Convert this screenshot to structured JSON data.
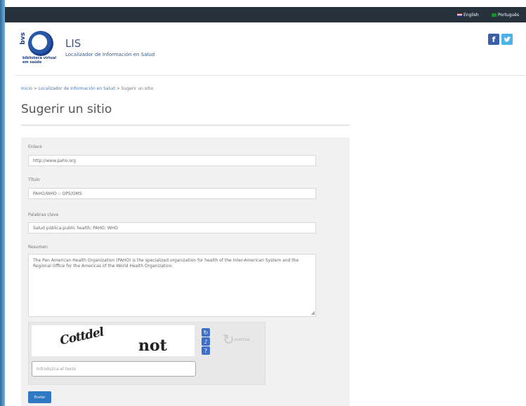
{
  "languages": {
    "english": "English",
    "portuguese": "Português"
  },
  "header": {
    "logo_side": "bvs",
    "logo_text": "biblioteca virtual em saúde",
    "app_name": "LIS",
    "app_subtitle": "Localizador de Información en Salud"
  },
  "social": {
    "facebook": "f",
    "twitter": "t"
  },
  "breadcrumb": {
    "home": "Inicio",
    "section": "Localizador de Información en Salud",
    "current": "Sugerir un sitio",
    "separator": ">"
  },
  "page_title": "Sugerir un sitio",
  "form": {
    "link_label": "Enlace",
    "link_value": "http://www.paho.org",
    "title_label": "Título",
    "title_value": "PAHO/WHO :: OPS/OMS",
    "keywords_label": "Palabras clave",
    "keywords_value": "Salud pública;public health; PAHO; WHO",
    "summary_label": "Resumen",
    "summary_value": "The Pan American Health Organization (PAHO) is the specialized organization for health of the Inter-American System and the Regional Office for the Americas of the World Health Organization."
  },
  "captcha": {
    "word1": "Cottdel",
    "word2": "not",
    "placeholder": "Introduzca el texto",
    "logo_text": "reCAPTCHA"
  },
  "submit_label": "Enviar",
  "colors": {
    "topbar": "#26323b",
    "accent": "#2f79c4",
    "panel": "#f1f1f1"
  }
}
